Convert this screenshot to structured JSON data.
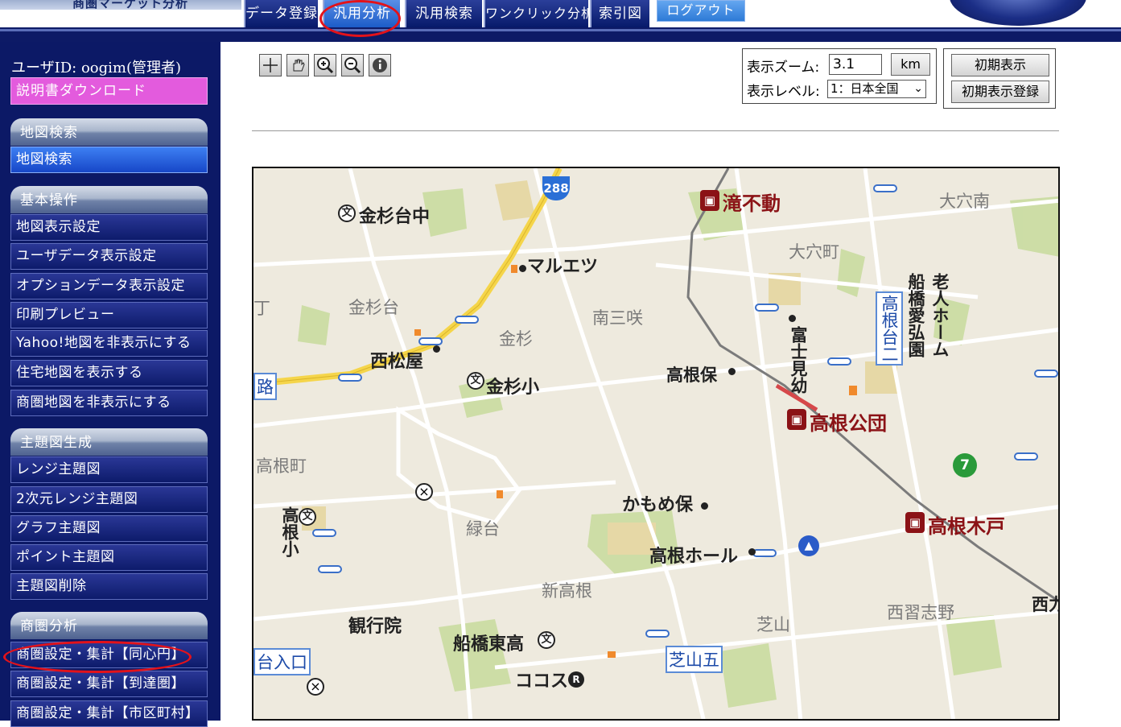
{
  "header": {
    "caption": "商圏マーケット分析",
    "tabs": [
      {
        "label": "データ登録",
        "active": false
      },
      {
        "label": "汎用分析",
        "active": true
      },
      {
        "label": "汎用検索",
        "active": false
      },
      {
        "label": "ワンクリック分析",
        "active": false
      },
      {
        "label": "索引図",
        "active": false
      }
    ],
    "logout_label": "ログアウト"
  },
  "sidebar": {
    "user_id": "ユーザID: oogim(管理者)",
    "manual_label": "説明書ダウンロード",
    "sections": [
      {
        "title": "地図検索",
        "items": [
          "地図検索"
        ]
      },
      {
        "title": "基本操作",
        "items": [
          "地図表示設定",
          "ユーザデータ表示設定",
          "オプションデータ表示設定",
          "印刷プレビュー",
          "Yahoo!地図を非表示にする",
          "住宅地図を表示する",
          "商圏地図を非表示にする"
        ]
      },
      {
        "title": "主題図生成",
        "items": [
          "レンジ主題図",
          "2次元レンジ主題図",
          "グラフ主題図",
          "ポイント主題図",
          "主題図削除"
        ]
      },
      {
        "title": "商圏分析",
        "items": [
          "商圏設定・集計【同心円】",
          "商圏設定・集計【到達圏】",
          "商圏設定・集計【市区町村】"
        ]
      }
    ]
  },
  "toolbar": {
    "tools": [
      "crosshair-icon",
      "pan-hand-icon",
      "zoom-in-icon",
      "zoom-out-icon",
      "info-icon"
    ],
    "zoom_label": "表示ズーム:",
    "zoom_value": "3.1",
    "zoom_unit": "km",
    "level_label": "表示レベル:",
    "level_value": "1：日本全国",
    "initial_view": "初期表示",
    "register_initial_view": "初期表示登録"
  },
  "map": {
    "labels": {
      "kinsugi_chu": "金杉台中",
      "maruetsu": "マルエツ",
      "route288": "288",
      "taki_fudo": "滝不動",
      "oana_minami": "大穴南",
      "oana_cho": "大穴町",
      "rojin_home": "老人ホーム",
      "funabashi_aikouen": "船橋愛弘園",
      "kinsugidai": "金杉台",
      "minami_misaki": "南三咲",
      "kinsugi": "金杉",
      "nishi_matsuya": "西松屋",
      "takane_dai_ni": "高根台二",
      "fujimi_you": "富士見幼",
      "takane_ho": "高根保",
      "kinsugi_sho": "金杉小",
      "ro": "路",
      "takane_koudan": "高根公団",
      "takane_cho": "高根町",
      "kamome_ho": "かもめ保",
      "takane_sho": "高根小",
      "midoridai": "緑台",
      "takane_kido": "高根木戸",
      "takane_hall": "高根ホール",
      "shin_takane": "新高根",
      "nishi_narashino": "西習志野",
      "kangyoin": "観行院",
      "shibayama": "芝山",
      "funabashi_higashi_ko": "船橋東高",
      "dai_iriguchi": "台入口",
      "shibayama_go": "芝山五",
      "cocos": "ココス",
      "nishi_edge": "西力",
      "left_edge": "丁"
    }
  }
}
